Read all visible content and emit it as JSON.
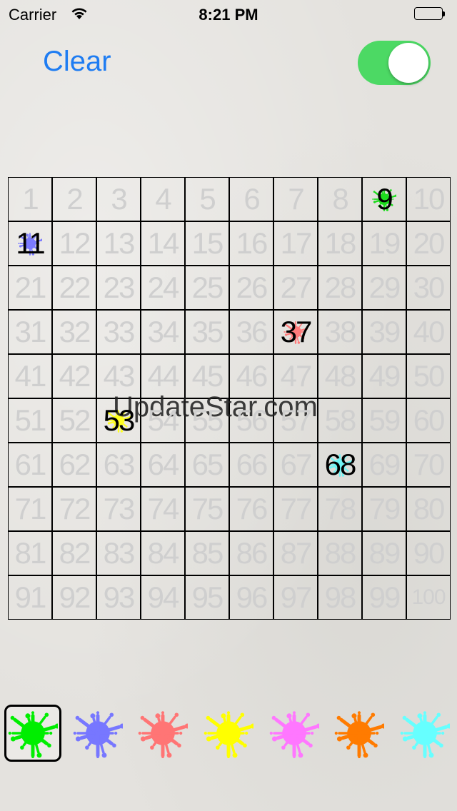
{
  "status_bar": {
    "carrier": "Carrier",
    "time": "8:21 PM"
  },
  "toolbar": {
    "clear_label": "Clear",
    "toggle_on": true,
    "toggle_color": "#4cd964"
  },
  "board": {
    "cells_total": 100,
    "marked": [
      {
        "number": 9,
        "color": "#1ddc1d"
      },
      {
        "number": 11,
        "color": "#7b7bff"
      },
      {
        "number": 37,
        "color": "#ff7b7b"
      },
      {
        "number": 53,
        "color": "#ffff22"
      },
      {
        "number": 68,
        "color": "#6ff5f5"
      }
    ]
  },
  "watermark": "UpdateStar.com",
  "palette": {
    "selected_index": 0,
    "colors": [
      {
        "name": "green",
        "hex": "#00ee00"
      },
      {
        "name": "blue",
        "hex": "#7777ff"
      },
      {
        "name": "red",
        "hex": "#ff7575"
      },
      {
        "name": "yellow",
        "hex": "#ffff00"
      },
      {
        "name": "magenta",
        "hex": "#ff77ff"
      },
      {
        "name": "orange",
        "hex": "#ff7b00"
      },
      {
        "name": "cyan",
        "hex": "#66ffff"
      }
    ]
  }
}
